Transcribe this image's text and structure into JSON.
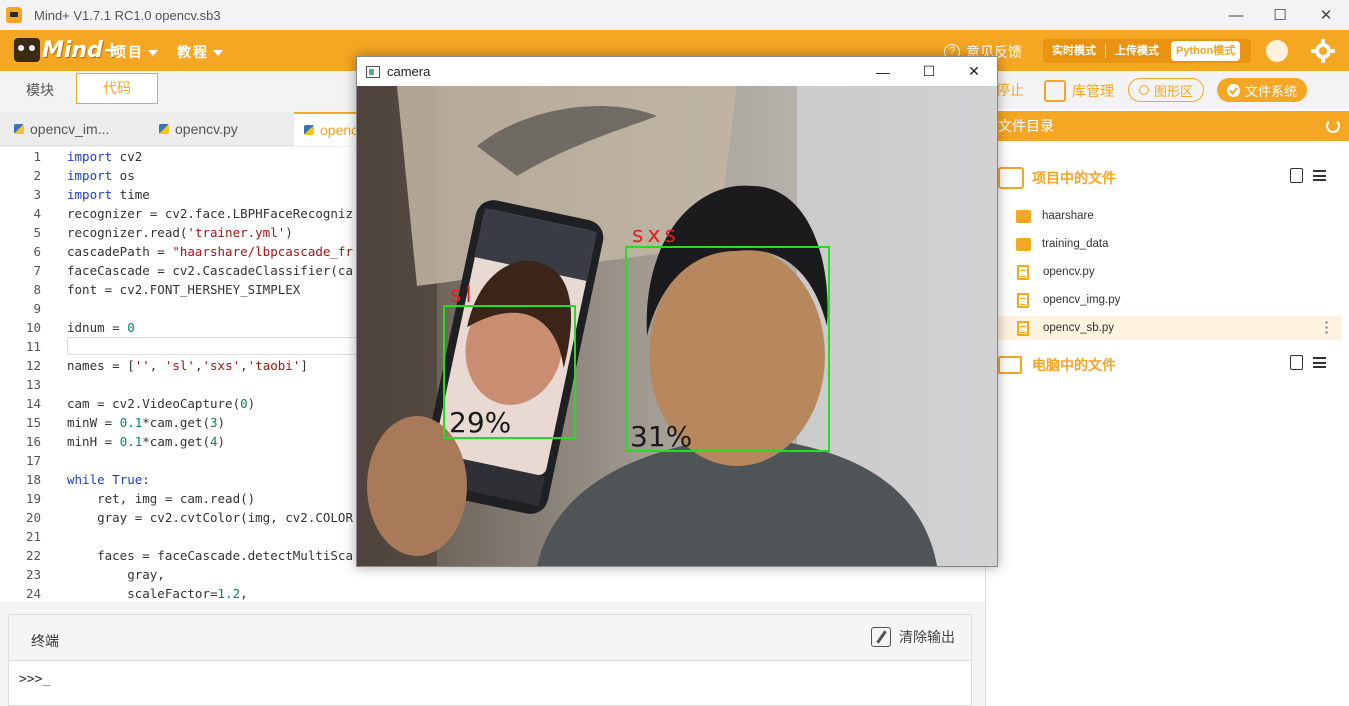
{
  "app": {
    "title": "Mind+ V1.7.1 RC1.0   opencv.sb3",
    "logo_text": "Mind+"
  },
  "menu": {
    "project": "项目",
    "tutorial": "教程",
    "feedback": "意见反馈"
  },
  "modes": {
    "realtime": "实时模式",
    "upload": "上传模式",
    "python": "Python模式"
  },
  "view_tabs": {
    "blocks": "模块",
    "code": "代码"
  },
  "file_tabs": [
    "opencv_im...",
    "opencv.py",
    "openc"
  ],
  "code_lines": [
    {
      "n": "1",
      "t": "import cv2"
    },
    {
      "n": "2",
      "t": "import os"
    },
    {
      "n": "3",
      "t": "import time"
    },
    {
      "n": "4",
      "t": "recognizer = cv2.face.LBPHFaceRecogniz"
    },
    {
      "n": "5",
      "t": "recognizer.read('trainer.yml')"
    },
    {
      "n": "6",
      "t": "cascadePath = \"haarshare/lbpcascade_fr"
    },
    {
      "n": "7",
      "t": "faceCascade = cv2.CascadeClassifier(ca"
    },
    {
      "n": "8",
      "t": "font = cv2.FONT_HERSHEY_SIMPLEX"
    },
    {
      "n": "9",
      "t": ""
    },
    {
      "n": "10",
      "t": "idnum = 0"
    },
    {
      "n": "11",
      "t": ""
    },
    {
      "n": "12",
      "t": "names = ['', 'sl','sxs','taobi']"
    },
    {
      "n": "13",
      "t": ""
    },
    {
      "n": "14",
      "t": "cam = cv2.VideoCapture(0)"
    },
    {
      "n": "15",
      "t": "minW = 0.1*cam.get(3)"
    },
    {
      "n": "16",
      "t": "minH = 0.1*cam.get(4)"
    },
    {
      "n": "17",
      "t": ""
    },
    {
      "n": "18",
      "t": "while True:"
    },
    {
      "n": "19",
      "t": "    ret, img = cam.read()"
    },
    {
      "n": "20",
      "t": "    gray = cv2.cvtColor(img, cv2.COLOR"
    },
    {
      "n": "21",
      "t": ""
    },
    {
      "n": "22",
      "t": "    faces = faceCascade.detectMultiSca"
    },
    {
      "n": "23",
      "t": "        gray,"
    },
    {
      "n": "24",
      "t": "        scaleFactor=1.2,"
    }
  ],
  "terminal": {
    "title": "终端",
    "clear": "清除输出",
    "prompt": ">>>_"
  },
  "right_toolbar": {
    "stop": "停止",
    "libs": "库管理",
    "graphics": "图形区",
    "filesystem": "文件系统"
  },
  "file_panel": {
    "header": "文件目录",
    "project_files": "项目中的文件",
    "computer_files": "电脑中的文件",
    "items": [
      {
        "name": "haarshare",
        "type": "folder"
      },
      {
        "name": "training_data",
        "type": "folder"
      },
      {
        "name": "opencv.py",
        "type": "file"
      },
      {
        "name": "opencv_img.py",
        "type": "file"
      },
      {
        "name": "opencv_sb.py",
        "type": "file"
      }
    ]
  },
  "camera_window": {
    "title": "camera",
    "faces": [
      {
        "name": "sl",
        "confidence": "29%"
      },
      {
        "name": "sxs",
        "confidence": "31%"
      }
    ]
  },
  "colors": {
    "accent": "#f5a623",
    "detect_box": "#22dd22",
    "label_red": "#e02020"
  }
}
